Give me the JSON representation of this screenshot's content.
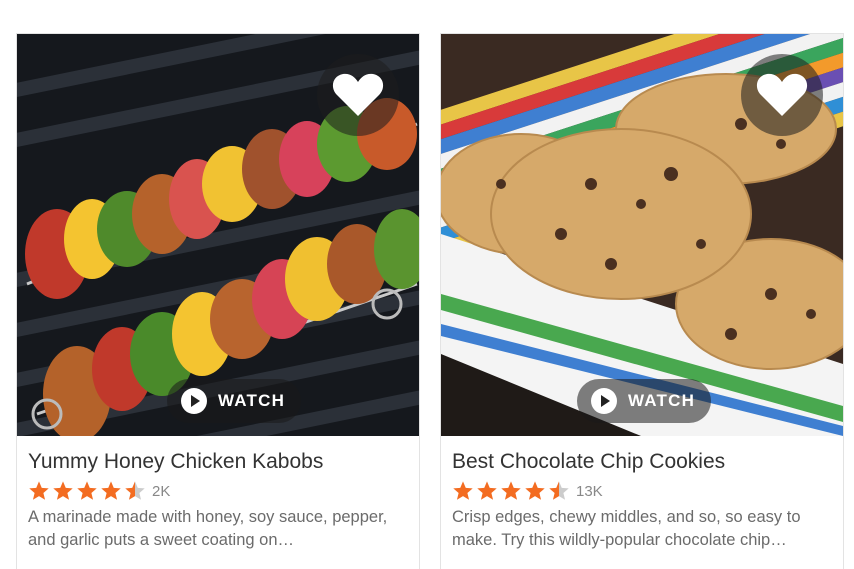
{
  "cards": [
    {
      "title": "Yummy Honey Chicken Kabobs",
      "rating": 4.5,
      "rating_count": "2K",
      "description": "A marinade made with honey, soy sauce, pepper, and garlic puts a sweet coating on…",
      "watch_label": "WATCH",
      "image_subject": "chicken kabobs on grill"
    },
    {
      "title": "Best Chocolate Chip Cookies",
      "rating": 4.5,
      "rating_count": "13K",
      "description": "Crisp edges, chewy middles, and so, so easy to make. Try this wildly-popular chocolate chip…",
      "watch_label": "WATCH",
      "image_subject": "chocolate chip cookies on striped plate"
    }
  ],
  "colors": {
    "star": "#f36c21",
    "star_empty": "#cccccc",
    "title_text": "#333333",
    "muted_text": "#6b6b6b"
  },
  "icons": {
    "favorite": "heart-icon",
    "play": "play-icon",
    "star": "star-icon"
  }
}
